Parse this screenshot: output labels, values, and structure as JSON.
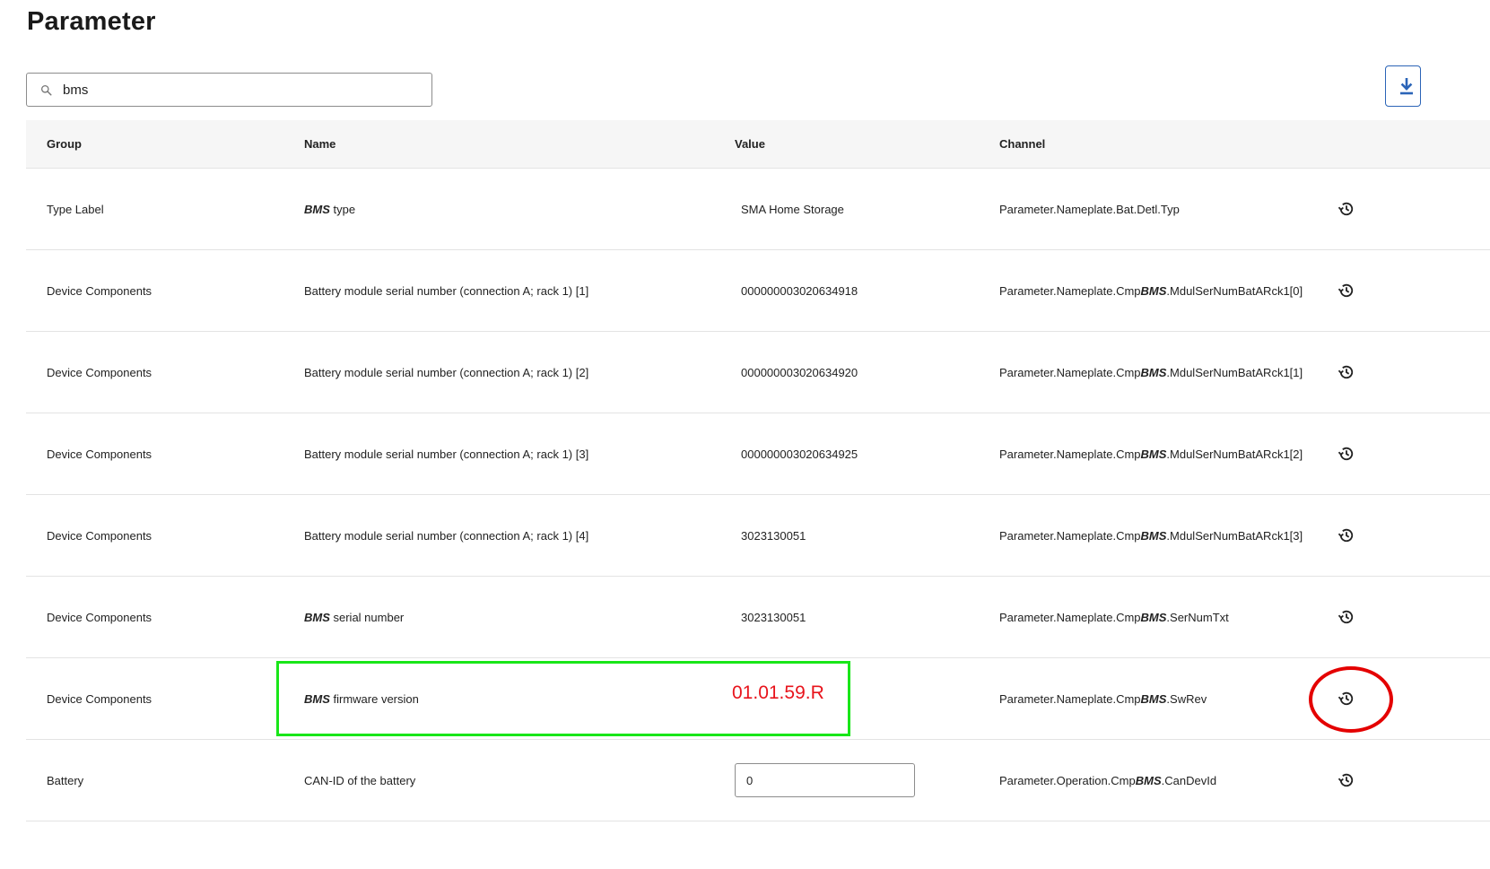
{
  "page": {
    "title": "Parameter"
  },
  "search": {
    "value": "bms",
    "placeholder": ""
  },
  "table": {
    "headers": {
      "group": "Group",
      "name": "Name",
      "value": "Value",
      "channel": "Channel"
    },
    "rows": [
      {
        "group": "Type Label",
        "name_pre": "",
        "name_em": "BMS",
        "name_post": " type",
        "value": "SMA Home Storage",
        "channel_pre": "Parameter.Nameplate.Bat.Detl.Typ",
        "channel_em": "",
        "channel_post": ""
      },
      {
        "group": "Device Components",
        "name_pre": "Battery module serial number (connection A; rack 1) [1]",
        "name_em": "",
        "name_post": "",
        "value": "000000003020634918",
        "channel_pre": "Parameter.Nameplate.Cmp",
        "channel_em": "BMS",
        "channel_post": ".MdulSerNumBatARck1[0]"
      },
      {
        "group": "Device Components",
        "name_pre": "Battery module serial number (connection A; rack 1) [2]",
        "name_em": "",
        "name_post": "",
        "value": "000000003020634920",
        "channel_pre": "Parameter.Nameplate.Cmp",
        "channel_em": "BMS",
        "channel_post": ".MdulSerNumBatARck1[1]"
      },
      {
        "group": "Device Components",
        "name_pre": "Battery module serial number (connection A; rack 1) [3]",
        "name_em": "",
        "name_post": "",
        "value": "000000003020634925",
        "channel_pre": "Parameter.Nameplate.Cmp",
        "channel_em": "BMS",
        "channel_post": ".MdulSerNumBatARck1[2]"
      },
      {
        "group": "Device Components",
        "name_pre": "Battery module serial number (connection A; rack 1) [4]",
        "name_em": "",
        "name_post": "",
        "value": "3023130051",
        "channel_pre": "Parameter.Nameplate.Cmp",
        "channel_em": "BMS",
        "channel_post": ".MdulSerNumBatARck1[3]"
      },
      {
        "group": "Device Components",
        "name_pre": "",
        "name_em": "BMS",
        "name_post": " serial number",
        "value": "3023130051",
        "channel_pre": "Parameter.Nameplate.Cmp",
        "channel_em": "BMS",
        "channel_post": ".SerNumTxt"
      },
      {
        "group": "Device Components",
        "name_pre": "",
        "name_em": "BMS",
        "name_post": " firmware version",
        "value": "",
        "channel_pre": "Parameter.Nameplate.Cmp",
        "channel_em": "BMS",
        "channel_post": ".SwRev"
      },
      {
        "group": "Battery",
        "name_pre": "CAN-ID of the battery",
        "name_em": "",
        "name_post": "",
        "value": "0",
        "channel_pre": "Parameter.Operation.Cmp",
        "channel_em": "BMS",
        "channel_post": ".CanDevId"
      }
    ]
  },
  "annotations": {
    "firmware_value": "01.01.59.R",
    "highlight_color": "#19e619",
    "circle_color": "#e40000"
  },
  "icons": {
    "search": "search-icon",
    "download": "download-icon",
    "history": "history-icon"
  },
  "colors": {
    "accent": "#2b64b7",
    "header_bg": "#f6f6f6",
    "row_border": "#e3e3e3"
  }
}
